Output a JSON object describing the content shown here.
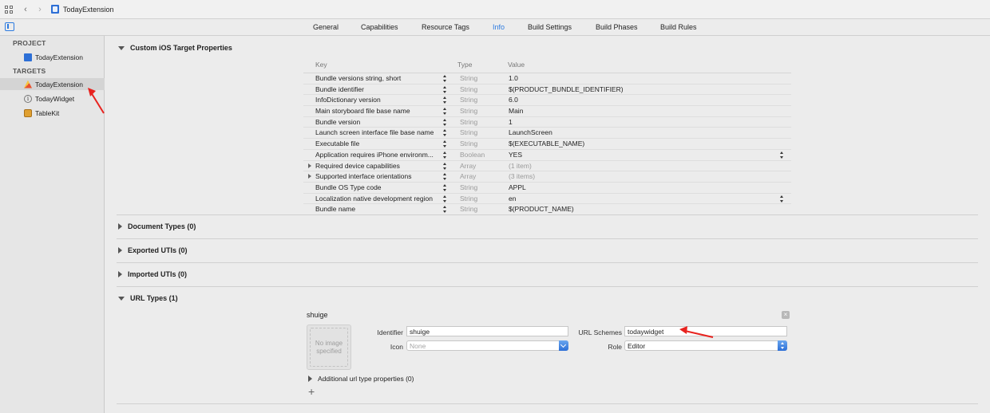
{
  "toolbar": {
    "breadcrumb": "TodayExtension"
  },
  "tabs": [
    {
      "label": "General"
    },
    {
      "label": "Capabilities"
    },
    {
      "label": "Resource Tags"
    },
    {
      "label": "Info",
      "active": true
    },
    {
      "label": "Build Settings"
    },
    {
      "label": "Build Phases"
    },
    {
      "label": "Build Rules"
    }
  ],
  "sidebar": {
    "project_header": "PROJECT",
    "project_item": "TodayExtension",
    "targets_header": "TARGETS",
    "targets": [
      {
        "label": "TodayExtension",
        "icon": "app-icon",
        "selected": true
      },
      {
        "label": "TodayWidget",
        "icon": "info-icon"
      },
      {
        "label": "TableKit",
        "icon": "toolbox-icon"
      }
    ]
  },
  "sections": {
    "custom_props": "Custom iOS Target Properties",
    "document_types": "Document Types (0)",
    "exported_utis": "Exported UTIs (0)",
    "imported_utis": "Imported UTIs (0)",
    "url_types": "URL Types (1)"
  },
  "properties": {
    "headers": {
      "key": "Key",
      "type": "Type",
      "value": "Value"
    },
    "rows": [
      {
        "key": "Bundle versions string, short",
        "type": "String",
        "value": "1.0"
      },
      {
        "key": "Bundle identifier",
        "type": "String",
        "value": "$(PRODUCT_BUNDLE_IDENTIFIER)"
      },
      {
        "key": "InfoDictionary version",
        "type": "String",
        "value": "6.0"
      },
      {
        "key": "Main storyboard file base name",
        "type": "String",
        "value": "Main"
      },
      {
        "key": "Bundle version",
        "type": "String",
        "value": "1"
      },
      {
        "key": "Launch screen interface file base name",
        "type": "String",
        "value": "LaunchScreen"
      },
      {
        "key": "Executable file",
        "type": "String",
        "value": "$(EXECUTABLE_NAME)"
      },
      {
        "key": "Application requires iPhone environm...",
        "type": "Boolean",
        "value": "YES"
      },
      {
        "key": "Required device capabilities",
        "type": "Array",
        "value": "(1 item)"
      },
      {
        "key": "Supported interface orientations",
        "type": "Array",
        "value": "(3 items)"
      },
      {
        "key": "Bundle OS Type code",
        "type": "String",
        "value": "APPL"
      },
      {
        "key": "Localization native development region",
        "type": "String",
        "value": "en"
      },
      {
        "key": "Bundle name",
        "type": "String",
        "value": "$(PRODUCT_NAME)"
      }
    ]
  },
  "url_type": {
    "name": "shuige",
    "image_placeholder": "No image specified",
    "identifier_label": "Identifier",
    "identifier_value": "shuige",
    "icon_label": "Icon",
    "icon_placeholder": "None",
    "schemes_label": "URL Schemes",
    "schemes_value": "todaywidget",
    "role_label": "Role",
    "role_value": "Editor",
    "additional": "Additional url type properties (0)",
    "add_symbol": "+"
  },
  "colors": {
    "accent": "#2d7be0",
    "annotation": "#e8231f"
  }
}
